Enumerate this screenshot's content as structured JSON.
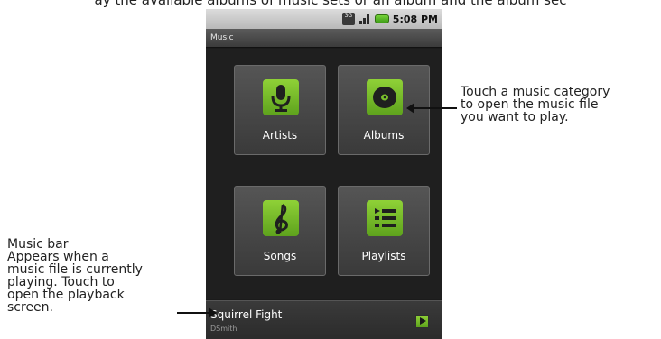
{
  "page": {
    "top_text": "ay the available albums of music sets or an album and the album sec"
  },
  "status_bar": {
    "network": "3G",
    "time": "5:08 PM"
  },
  "app": {
    "title": "Music"
  },
  "categories": [
    {
      "label": "Artists",
      "icon": "microphone-icon"
    },
    {
      "label": "Albums",
      "icon": "disc-icon"
    },
    {
      "label": "Songs",
      "icon": "treble-clef-icon"
    },
    {
      "label": "Playlists",
      "icon": "playlist-icon"
    }
  ],
  "music_bar": {
    "song": "Squirrel Fight",
    "artist": "DSmith"
  },
  "callouts": {
    "right": [
      "Touch a music category",
      "to open the music file",
      "you want to play."
    ],
    "left": [
      "Music bar",
      "Appears when a",
      "music file is currently",
      "playing. Touch to",
      "open the playback",
      "screen."
    ]
  },
  "colors": {
    "icon_green": "#7bc12b",
    "tile_gray": "#4a4a4a",
    "screen_bg": "#1b1b1b"
  }
}
